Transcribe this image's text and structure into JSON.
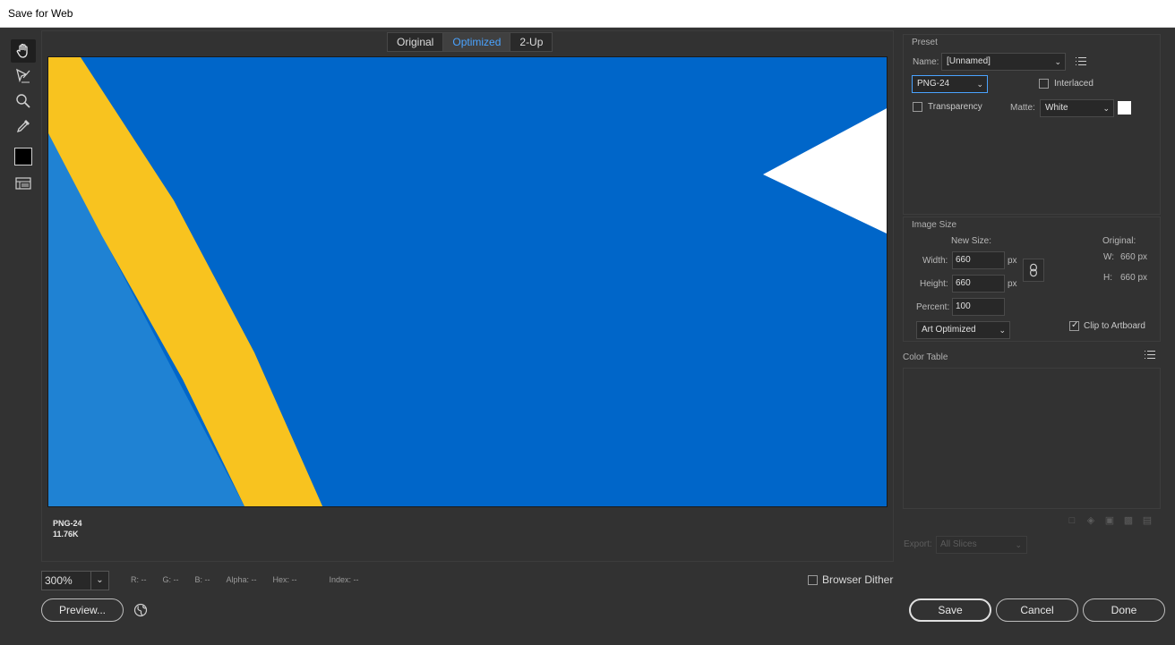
{
  "window": {
    "title": "Save for Web"
  },
  "tools": [
    {
      "name": "hand-tool-icon"
    },
    {
      "name": "slice-select-tool-icon"
    },
    {
      "name": "zoom-tool-icon"
    },
    {
      "name": "eyedropper-tool-icon"
    },
    {
      "name": "eyedropper-color-swatch",
      "color": "#000000"
    },
    {
      "name": "toggle-slices-icon"
    }
  ],
  "view_tabs": [
    "Original",
    "Optimized",
    "2-Up"
  ],
  "active_tab": "Optimized",
  "canvas": {
    "background": "#0066c9",
    "stripe_color": "#f8c31f",
    "light_color": "#1f82d3",
    "triangle_color": "#ffffff"
  },
  "preview_info": {
    "format": "PNG-24",
    "size": "11.76K"
  },
  "zoom": {
    "value": "300%"
  },
  "readouts": {
    "r": "R: --",
    "g": "G: --",
    "b": "B: --",
    "alpha": "Alpha: --",
    "hex": "Hex: --",
    "index": "Index: --"
  },
  "browser_dither": {
    "label": "Browser Dither",
    "checked": false
  },
  "buttons": {
    "preview": "Preview...",
    "save": "Save",
    "cancel": "Cancel",
    "done": "Done"
  },
  "preset": {
    "section_title": "Preset",
    "name_label": "Name:",
    "name_value": "[Unnamed]",
    "format_value": "PNG-24",
    "interlaced_label": "Interlaced",
    "interlaced_checked": false,
    "transparency_label": "Transparency",
    "transparency_checked": false,
    "matte_label": "Matte:",
    "matte_value": "White",
    "matte_color": "#ffffff"
  },
  "image_size": {
    "section_title": "Image Size",
    "new_size_label": "New Size:",
    "width_label": "Width:",
    "width_value": "660",
    "height_label": "Height:",
    "height_value": "660",
    "percent_label": "Percent:",
    "percent_value": "100",
    "unit_px": "px",
    "original_label": "Original:",
    "orig_w_label": "W:",
    "orig_w_value": "660 px",
    "orig_h_label": "H:",
    "orig_h_value": "660 px",
    "resample_value": "Art Optimized",
    "clip_label": "Clip to Artboard",
    "clip_checked": true
  },
  "color_table": {
    "section_title": "Color Table"
  },
  "export": {
    "label": "Export:",
    "value": "All Slices"
  }
}
